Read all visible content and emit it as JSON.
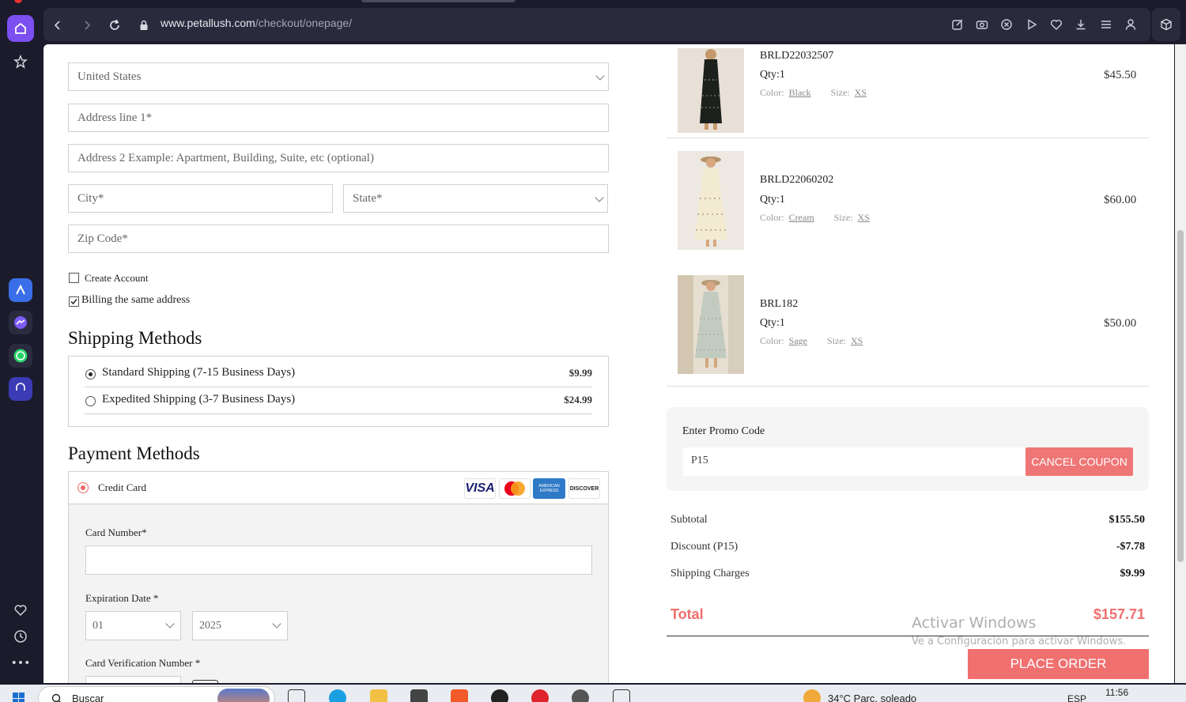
{
  "browser": {
    "url_domain": "www.petallush.com",
    "url_path": "/checkout/onepage/"
  },
  "address": {
    "country": "United States",
    "address1_placeholder": "Address line 1*",
    "address2_placeholder": "Address 2 Example: Apartment, Building, Suite, etc (optional)",
    "city_placeholder": "City*",
    "state_placeholder": "State*",
    "zip_placeholder": "Zip Code*",
    "create_account": "Create Account",
    "billing_same": "Billing the same address"
  },
  "shipping": {
    "title": "Shipping Methods",
    "options": [
      {
        "name": "Standard Shipping (7-15 Business Days)",
        "price": "$9.99",
        "selected": true
      },
      {
        "name": "Expedited Shipping (3-7 Business Days)",
        "price": "$24.99",
        "selected": false
      }
    ]
  },
  "payment": {
    "title": "Payment Methods",
    "method": "Credit Card",
    "card_logos": [
      "VISA",
      "mastercard",
      "AMERICAN EXPRESS",
      "DISCOVER"
    ],
    "card_number_label": "Card Number*",
    "expiration_label": "Expiration Date *",
    "exp_month": "01",
    "exp_year": "2025",
    "cvv_label": "Card Verification Number *"
  },
  "cart": {
    "items": [
      {
        "sku": "BRLD22032507",
        "qty": "Qty:1",
        "color_label": "Color:",
        "color": "Black",
        "size_label": "Size:",
        "size": "XS",
        "price": "$45.50"
      },
      {
        "sku": "BRLD22060202",
        "qty": "Qty:1",
        "color_label": "Color:",
        "color": "Cream",
        "size_label": "Size:",
        "size": "XS",
        "price": "$60.00"
      },
      {
        "sku": "BRL182",
        "qty": "Qty:1",
        "color_label": "Color:",
        "color": "Sage",
        "size_label": "Size:",
        "size": "XS",
        "price": "$50.00"
      }
    ]
  },
  "promo": {
    "label": "Enter Promo Code",
    "code": "P15",
    "cancel_label": "CANCEL COUPON"
  },
  "summary": {
    "subtotal_label": "Subtotal",
    "subtotal": "$155.50",
    "discount_label": "Discount (P15)",
    "discount": "-$7.78",
    "shipping_label": "Shipping Charges",
    "shipping": "$9.99",
    "total_label": "Total",
    "total": "$157.71",
    "place_order": "PLACE ORDER"
  },
  "watermark": {
    "line1": "Activar Windows",
    "line2": "Ve a Configuración para activar Windows."
  },
  "taskbar": {
    "search": "Buscar",
    "weather": "34°C  Parc. soleado",
    "lang": "ESP",
    "time": "11:56"
  },
  "colors": {
    "accent": "#f07070",
    "opera_purple": "#7b4ff0"
  }
}
